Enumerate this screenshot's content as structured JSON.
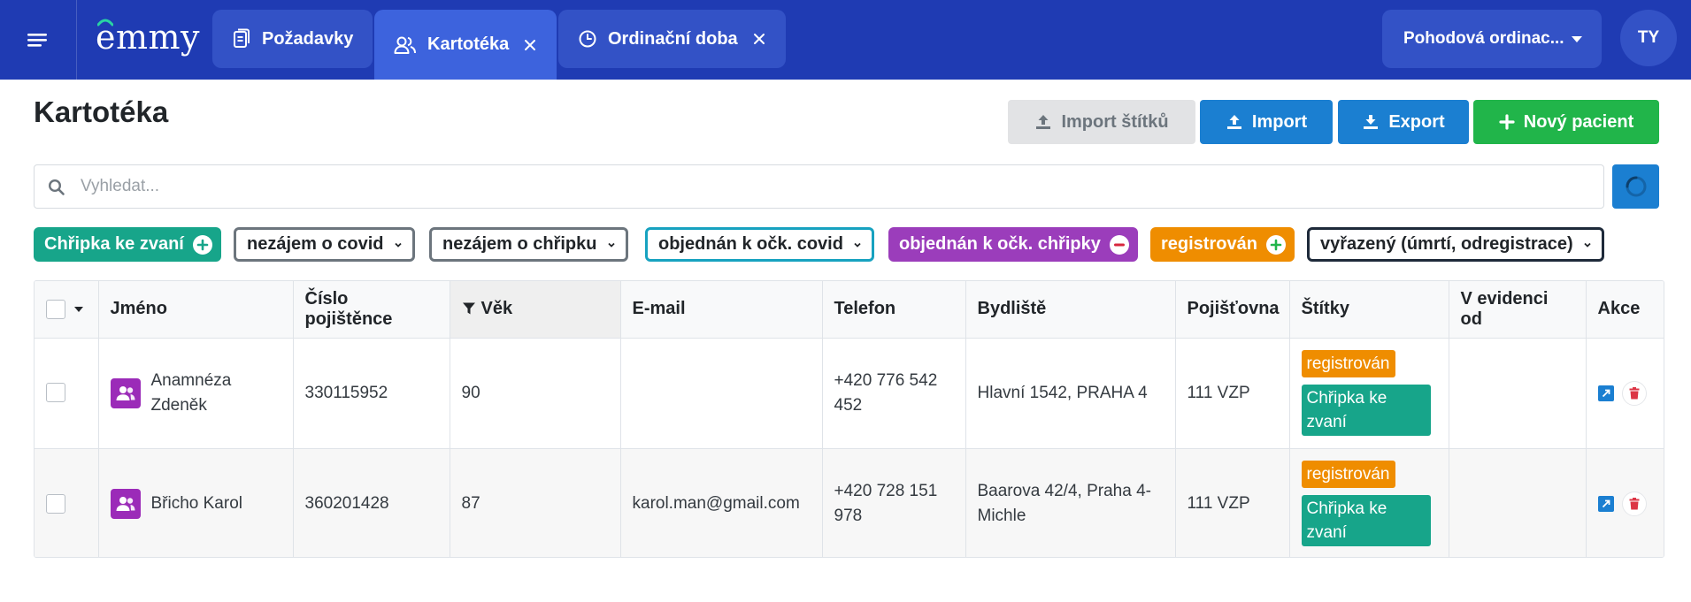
{
  "app": {
    "logo_text": "emmy",
    "tabs": [
      {
        "label": "Požadavky"
      },
      {
        "label": "Kartotéka"
      },
      {
        "label": "Ordinační doba"
      }
    ],
    "clinic_select": "Pohodová ordinac...",
    "user_initials": "TY"
  },
  "page": {
    "title": "Kartotéka",
    "buttons": {
      "import_tags": "Import štítků",
      "import": "Import",
      "export": "Export",
      "new_patient": "Nový pacient"
    }
  },
  "search": {
    "placeholder": "Vyhledat...",
    "value": ""
  },
  "filters": [
    {
      "label": "Chřipka ke zvaní",
      "style": "solid",
      "color": "#17a58a",
      "icon": "plus-circle-icon"
    },
    {
      "label": "nezájem o covid",
      "style": "outline",
      "color": "#6c757d",
      "icon": "chevron-down-icon"
    },
    {
      "label": "nezájem o chřipku",
      "style": "outline",
      "color": "#6c757d",
      "icon": "chevron-down-icon"
    },
    {
      "label": "objednán k očk. covid",
      "style": "outline",
      "color": "#17a2c0",
      "icon": "chevron-down-icon"
    },
    {
      "label": "objednán k očk. chřipky",
      "style": "solid",
      "color": "#9b3dbb",
      "icon": "minus-circle-icon"
    },
    {
      "label": "registrován",
      "style": "solid",
      "color": "#ef8d00",
      "icon": "plus-circle-icon"
    },
    {
      "label": "vyřazený (úmrtí, odregistrace)",
      "style": "outline",
      "color": "#1e2a3a",
      "icon": "chevron-down-icon"
    }
  ],
  "table": {
    "columns": {
      "name": "Jméno",
      "insurance_number": "Číslo pojištěnce",
      "age": "Věk",
      "email": "E-mail",
      "phone": "Telefon",
      "address": "Bydliště",
      "insurer": "Pojišťovna",
      "tags": "Štítky",
      "registered_since": "V evidenci od",
      "actions": "Akce"
    },
    "rows": [
      {
        "name": "Anamnéza Zdeněk",
        "insurance_number": "330115952",
        "age": "90",
        "email": "",
        "phone": "+420 776 542 452",
        "address": "Hlavní 1542, PRAHA 4",
        "insurer": "111 VZP",
        "tags": [
          "registrován",
          "Chřipka ke zvaní"
        ],
        "registered_since": ""
      },
      {
        "name": "Břicho Karol",
        "insurance_number": "360201428",
        "age": "87",
        "email": "karol.man@gmail.com",
        "phone": "+420 728 151 978",
        "address": "Baarova 42/4, Praha 4-Michle",
        "insurer": "111 VZP",
        "tags": [
          "registrován",
          "Chřipka ke zvaní"
        ],
        "registered_since": ""
      }
    ]
  },
  "colors": {
    "navbar": "#1f3bb3",
    "primary": "#1b7fd1",
    "success": "#21b54a",
    "patient_icon": "#9b2bb8"
  }
}
